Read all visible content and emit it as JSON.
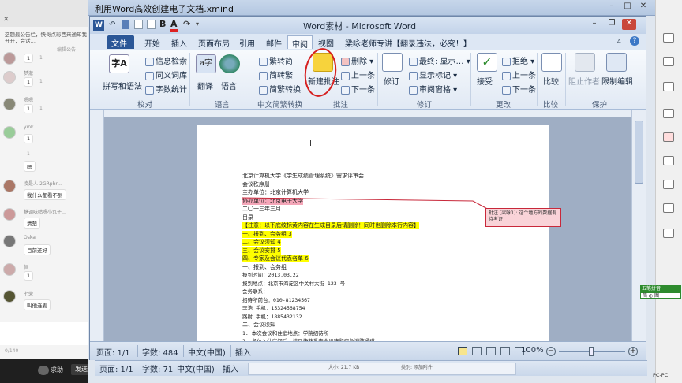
{
  "bg_window": {
    "title": "利用Word高效创建电子文档.xmind"
  },
  "chat": {
    "note": "这题最公告栏，快哥点彩西来通知我开开，会话…",
    "notice": "编辑公告",
    "messages": [
      {
        "user": "",
        "text": "1",
        "count": "1"
      },
      {
        "user": "梦澈",
        "text": "1",
        "count": "1"
      },
      {
        "user": "嗯嗯",
        "text": "1",
        "count": "1"
      },
      {
        "user": "yink",
        "text": "1",
        "count": ""
      },
      {
        "user": "",
        "text": "嗯",
        "count": "1"
      },
      {
        "user": "凌是人-2GRphr…",
        "text": "我什么都看不到",
        "count": ""
      },
      {
        "user": "糖调味咕噜小丸子…",
        "text": "清楚",
        "count": ""
      },
      {
        "user": "Oska",
        "text": "目前还好",
        "count": ""
      },
      {
        "user": "恒",
        "text": "1",
        "count": ""
      },
      {
        "user": "七荣",
        "text": "叫他连麦",
        "count": ""
      }
    ],
    "char_count": "0/140",
    "ask_label": "求助",
    "send_label": "发送"
  },
  "window": {
    "title": "Word素材 - Microsoft Word"
  },
  "tabs": [
    "文件",
    "开始",
    "插入",
    "页面布局",
    "引用",
    "邮件",
    "审阅",
    "视图",
    "梁咏老师专讲【翻录违法，必究！】"
  ],
  "active_tab": "审阅",
  "ribbon": {
    "groups": [
      {
        "label": "校对",
        "buttons": [
          "拼写和语法",
          "信息检索",
          "同义词库",
          "字数统计"
        ]
      },
      {
        "label": "语言",
        "buttons": [
          "翻译",
          "语言"
        ]
      },
      {
        "label": "中文简繁转换",
        "buttons": [
          "繁转简",
          "简转繁",
          "简繁转换"
        ]
      },
      {
        "label": "批注",
        "buttons": [
          "新建批注",
          "删除",
          "上一条",
          "下一条"
        ]
      },
      {
        "label": "修订",
        "buttons": [
          "修订",
          "最终: 显示…",
          "显示标记",
          "审阅窗格"
        ]
      },
      {
        "label": "更改",
        "buttons": [
          "接受",
          "拒绝",
          "上一条",
          "下一条"
        ]
      },
      {
        "label": "比较",
        "buttons": [
          "比较"
        ]
      },
      {
        "label": "保护",
        "buttons": [
          "阻止作者",
          "限制编辑"
        ]
      }
    ]
  },
  "document": {
    "lines": [
      {
        "text": "北京计算机大学《学生成绩管理系统》需求评审会",
        "style": ""
      },
      {
        "text": "会议秩序册",
        "style": ""
      },
      {
        "text": "主办单位：北京计算机大学",
        "style": ""
      },
      {
        "text": "协办单位：北京电子大学",
        "style": "ins"
      },
      {
        "text": "二〇一三年三月",
        "style": ""
      },
      {
        "text": "目录",
        "style": ""
      },
      {
        "text": "【注意：以下底纹标黄内容在生成目录后请删除！同时也删除本行内容】",
        "style": "hl"
      },
      {
        "text": "一、报到、会务组      3",
        "style": "hl"
      },
      {
        "text": "二、会议须知      4",
        "style": "hl"
      },
      {
        "text": "三、会议安排      5",
        "style": "hl"
      },
      {
        "text": "四、专家及会议代表名单    6",
        "style": "hl"
      },
      {
        "text": "一、报到、会务组",
        "style": ""
      },
      {
        "text": "报到时间：2013.03.22",
        "style": "mono"
      },
      {
        "text": "报到地点：北京市海淀区中关村大街 123 号",
        "style": "mono"
      },
      {
        "text": "会务联系：",
        "style": "mono"
      },
      {
        "text": "招待所前台：010-81234567",
        "style": "mono"
      },
      {
        "text": "李浩 手机：15324568754",
        "style": "mono"
      },
      {
        "text": "路射 手机：1885432132",
        "style": "mono"
      },
      {
        "text": "二、会议须知",
        "style": ""
      },
      {
        "text": "1. 本次会议和住宿地点：学院招待所",
        "style": "mono"
      },
      {
        "text": "2. 各位入住房间后，请尽快熟悉安全设施和应急消防通道；",
        "style": "mono"
      },
      {
        "text": "3. 请遵守宾馆的规章制度，注意人身安全及保护好随身携带的物品，如需宾馆",
        "style": "mono"
      }
    ],
    "comment": "批注 [梁咏1]: 这个地方的数据有待考证"
  },
  "status": {
    "page": "页面: 1/1",
    "words": "字数: 484",
    "lang": "中文(中国)",
    "mode": "插入",
    "zoom": "100%"
  },
  "bg_status": {
    "page": "页面: 1/1",
    "words": "字数: 71",
    "lang": "中文(中国)",
    "mode": "插入",
    "file_size": "大小: 21.7 KB",
    "file_type": "类别: 添加附件"
  },
  "right_panel": {
    "badge_top": "五笔拼音",
    "badge_bottom": "简 ◐ 图",
    "bottom_label": "PC-PC"
  },
  "accent_colors": {
    "file_tab": "#2b5797",
    "highlight": "#ffff00",
    "insertion": "#f4a6b8",
    "comment_border": "#c8283a"
  }
}
